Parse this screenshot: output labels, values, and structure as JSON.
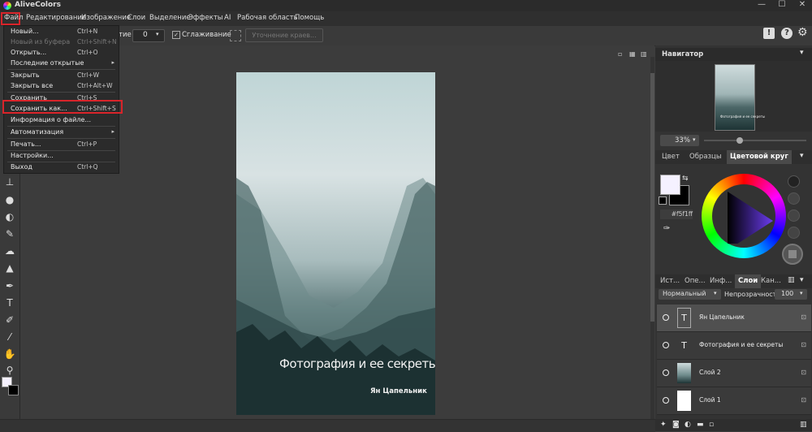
{
  "app": {
    "title": "AliveColors"
  },
  "window": {
    "minimize": "—",
    "maximize": "☐",
    "close": "✕"
  },
  "menubar": {
    "items": [
      "Файл",
      "Редактирование",
      "Изображение",
      "Слои",
      "Выделение",
      "Эффекты",
      "AI",
      "Рабочая область",
      "Помощь"
    ]
  },
  "options": {
    "label_tolerance": "тие",
    "tolerance_value": "0",
    "antialias_label": "Сглаживание",
    "refine_button": "Уточнение краев..."
  },
  "file_menu": {
    "items": [
      {
        "label": "Новый...",
        "shortcut": "Ctrl+N",
        "disabled": false
      },
      {
        "label": "Новый из буфера",
        "shortcut": "Ctrl+Shift+N",
        "disabled": true
      },
      {
        "label": "Открыть...",
        "shortcut": "Ctrl+O",
        "disabled": false
      },
      {
        "label": "Последние открытые",
        "shortcut": "",
        "disabled": false,
        "submenu": true
      },
      {
        "label": "Закрыть",
        "shortcut": "Ctrl+W",
        "disabled": false
      },
      {
        "label": "Закрыть все",
        "shortcut": "Ctrl+Alt+W",
        "disabled": false
      },
      {
        "label": "Сохранить",
        "shortcut": "Ctrl+S",
        "disabled": false
      },
      {
        "label": "Сохранить как...",
        "shortcut": "Ctrl+Shift+S",
        "disabled": false
      },
      {
        "label": "Информация о файле...",
        "shortcut": "",
        "disabled": false
      },
      {
        "label": "Автоматизация",
        "shortcut": "",
        "disabled": false,
        "submenu": true
      },
      {
        "label": "Печать...",
        "shortcut": "Ctrl+P",
        "disabled": false
      },
      {
        "label": "Настройки...",
        "shortcut": "",
        "disabled": false
      },
      {
        "label": "Выход",
        "shortcut": "Ctrl+Q",
        "disabled": false
      }
    ],
    "submenu_arrow": "▸"
  },
  "document": {
    "title_text": "Фотография и ее секреты",
    "author_text": "Ян Цапельник",
    "navigator_title_text": "Фотография и ее секреты"
  },
  "navigator": {
    "title": "Навигатор",
    "zoom": "33%"
  },
  "color_panel": {
    "tabs": [
      "Цвет",
      "Образцы",
      "Цветовой круг"
    ],
    "active_tab": 2,
    "hex": "#f5f1ff",
    "fg_color": "#f5f1ff",
    "bg_color": "#000000"
  },
  "layers_panel": {
    "tabs": [
      "Ист...",
      "Опе...",
      "Инф...",
      "Слои",
      "Кан..."
    ],
    "active_tab": 3,
    "blend_mode": "Нормальный",
    "opacity_label": "Непрозрачность",
    "opacity_value": "100",
    "layers": [
      {
        "name": "Ян Цапельник",
        "type": "text",
        "selected": true
      },
      {
        "name": "Фотография и ее секреты",
        "type": "text",
        "selected": false
      },
      {
        "name": "Слой 2",
        "type": "image",
        "selected": false
      },
      {
        "name": "Слой 1",
        "type": "white",
        "selected": false
      }
    ]
  },
  "icons": {
    "text_layer": "T",
    "lock": "🔒"
  },
  "colors": {
    "accent_red": "#d9242a",
    "panel_bg": "#333333"
  }
}
